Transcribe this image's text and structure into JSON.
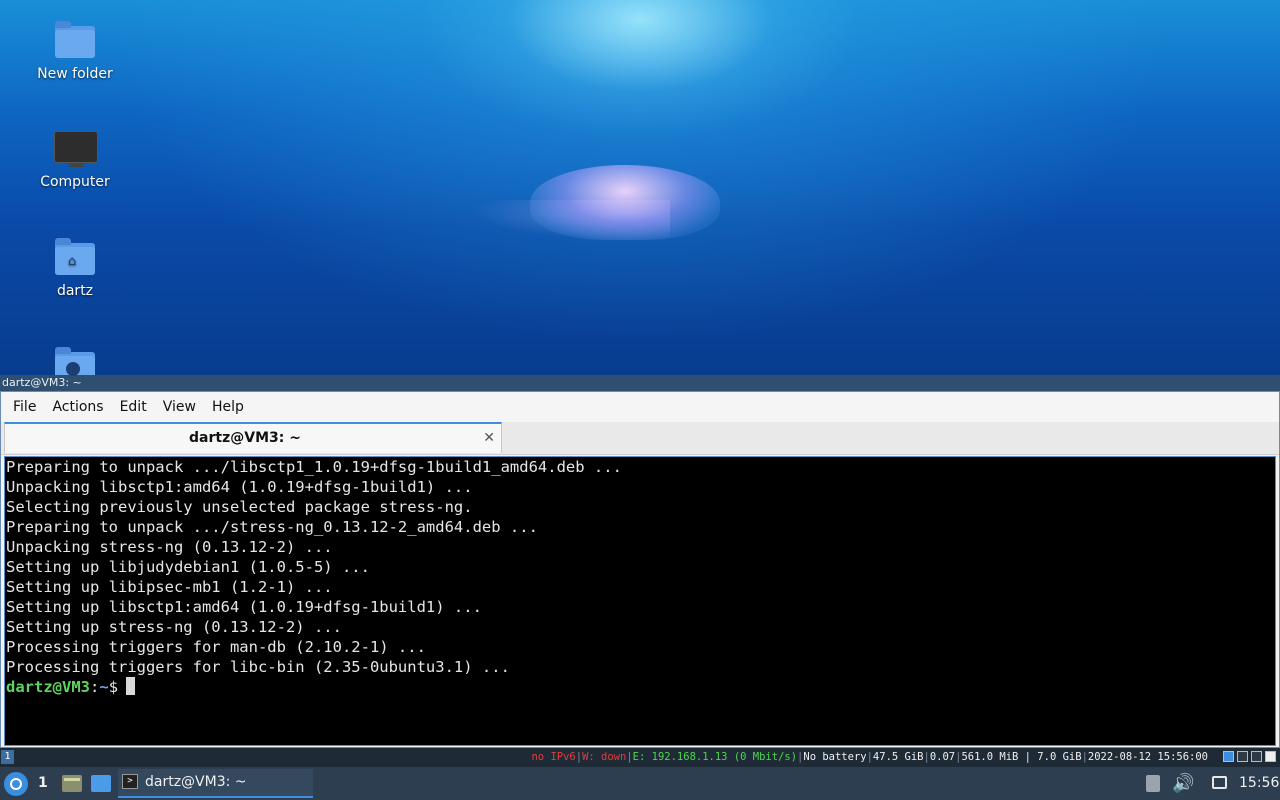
{
  "desktop": {
    "icons": [
      {
        "label": "New folder",
        "icon": "folder-icon"
      },
      {
        "label": "Computer",
        "icon": "computer-icon"
      },
      {
        "label": "dartz",
        "icon": "home-folder-icon"
      },
      {
        "label": "",
        "icon": "network-folder-icon"
      }
    ]
  },
  "window": {
    "title": "dartz@VM3: ~",
    "menu": [
      "File",
      "Actions",
      "Edit",
      "View",
      "Help"
    ],
    "tab": {
      "label": "dartz@VM3: ~",
      "close_icon": "close-icon"
    }
  },
  "terminal": {
    "lines": [
      "Preparing to unpack .../libsctp1_1.0.19+dfsg-1build1_amd64.deb ...",
      "Unpacking libsctp1:amd64 (1.0.19+dfsg-1build1) ...",
      "Selecting previously unselected package stress-ng.",
      "Preparing to unpack .../stress-ng_0.13.12-2_amd64.deb ...",
      "Unpacking stress-ng (0.13.12-2) ...",
      "Setting up libjudydebian1 (1.0.5-5) ...",
      "Setting up libipsec-mb1 (1.2-1) ...",
      "Setting up libsctp1:amd64 (1.0.19+dfsg-1build1) ...",
      "Setting up stress-ng (0.13.12-2) ...",
      "Processing triggers for man-db (2.10.2-1) ...",
      "Processing triggers for libc-bin (2.35-0ubuntu3.1) ..."
    ],
    "prompt": {
      "user_host": "dartz@VM3",
      "colon": ":",
      "path": "~",
      "symbol": "$"
    }
  },
  "statusbar": {
    "workspace": "1",
    "ipv6": "no IPv6",
    "wifi": "W: down",
    "ethernet": "E: 192.168.1.13 (0 Mbit/s)",
    "battery": "No battery",
    "disk": "47.5 GiB",
    "load": "0.07",
    "memory": "561.0 MiB | 7.0 GiB",
    "datetime": "2022-08-12 15:56:00",
    "separator": "|"
  },
  "taskbar": {
    "desktop_number": "1",
    "task_label": "dartz@VM3: ~",
    "clock": "15:56"
  },
  "colors": {
    "prompt_user": "#5fd35f",
    "prompt_path": "#6ea6ee",
    "status_red": "#e03c3c",
    "status_green": "#4fd64f",
    "accent": "#3d8ee0"
  }
}
